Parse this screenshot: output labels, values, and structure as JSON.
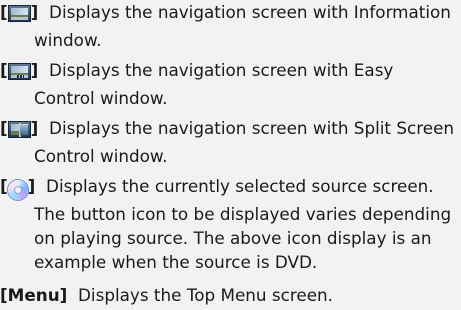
{
  "entries": [
    {
      "icon": "navigation-info-window-icon",
      "bracket_open": "[",
      "bracket_close": "]",
      "text": "Displays the navigation screen with Information window."
    },
    {
      "icon": "navigation-easy-control-window-icon",
      "bracket_open": "[",
      "bracket_close": "]",
      "text": "Displays the navigation screen with Easy Control window."
    },
    {
      "icon": "navigation-split-screen-control-window-icon",
      "bracket_open": "[",
      "bracket_close": "]",
      "text": "Displays the navigation screen with Split Screen Control window."
    },
    {
      "icon": "dvd-disc-icon",
      "bracket_open": "[",
      "bracket_close": "]",
      "text": "Displays the currently selected source screen. The button icon to be displayed varies depending on playing source. The above icon display is an example when the source is DVD."
    },
    {
      "key_label": "[Menu]",
      "text": "Displays the Top Menu screen."
    }
  ]
}
